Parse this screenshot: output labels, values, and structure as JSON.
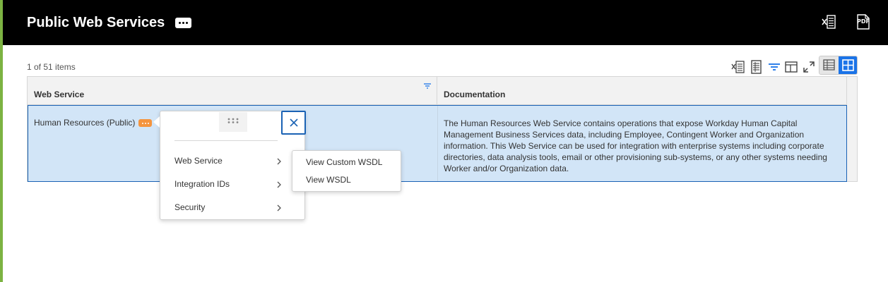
{
  "header": {
    "title": "Public Web Services",
    "title_more_icon": "ellipsis-icon",
    "actions": [
      {
        "name": "export-to-excel",
        "icon": "excel-export-icon"
      },
      {
        "name": "export-to-pdf",
        "icon": "pdf-export-icon",
        "label": "PDF"
      }
    ]
  },
  "grid": {
    "item_count": "1 of 51 items",
    "toolbar": [
      "excel-export-icon",
      "worksheet-icon",
      "filter-icon",
      "column-layout-icon",
      "fullscreen-icon"
    ],
    "view_modes": [
      "table-view-icon",
      "grid-view-icon"
    ],
    "columns": [
      "Web Service",
      "Documentation"
    ],
    "rows": [
      {
        "web_service": "Human Resources (Public)",
        "documentation": "The Human Resources Web Service contains operations that expose Workday Human Capital Management Business Services data, including Employee, Contingent Worker and Organization information. This Web Service can be used for integration with enterprise systems including corporate directories, data analysis tools, email or other provisioning sub-systems, or any other systems needing Worker and/or Organization data."
      }
    ]
  },
  "related_actions": {
    "items": [
      "Web Service",
      "Integration IDs",
      "Security"
    ],
    "submenu": [
      "View Custom WSDL",
      "View WSDL"
    ]
  },
  "colors": {
    "header_bg": "#000000",
    "accent_green": "#7cb342",
    "selected_row": "#d2e5f7",
    "selection_border": "#1a62b4",
    "related_actions_orange": "#f4943e",
    "active_blue": "#1a73e8"
  }
}
